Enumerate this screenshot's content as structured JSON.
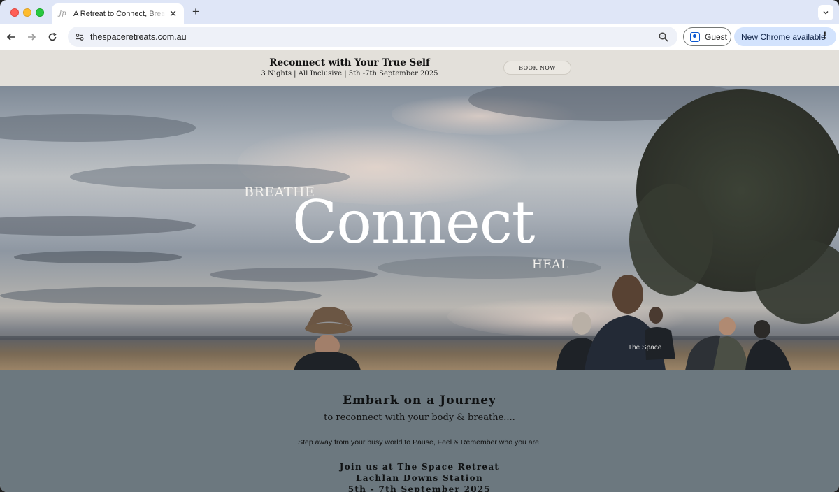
{
  "browser": {
    "tab": {
      "favicon": "Jp",
      "title": "A Retreat to Connect, Breathe & Heal",
      "close_icon": "close-icon"
    },
    "new_tab_icon": "plus-icon",
    "tab_search_icon": "chevron-down-icon",
    "nav": {
      "back_icon": "arrow-left-icon",
      "forward_icon": "arrow-right-icon",
      "reload_icon": "reload-icon"
    },
    "url": "thespaceretreats.com.au",
    "guest_label": "Guest",
    "update_label": "New Chrome available",
    "colors": {
      "tabbar": "#dfe6f7",
      "update_bg": "#d3e3fd",
      "accent": "#0b57d0"
    }
  },
  "announcement": {
    "title": "Reconnect with Your True Self",
    "subtitle": "3 Nights | All Inclusive | 5th -7th September 2025",
    "book_label": "BOOK NOW"
  },
  "hero": {
    "word_top": "BREATHE",
    "word_main": "Connect",
    "word_bottom": "HEAL",
    "shirt_text": "The Space"
  },
  "intro": {
    "title": "Embark on a Journey",
    "subtitle": "to reconnect with your body & breathe....",
    "body": "Step away from your busy world to Pause, Feel & Remember who you are.",
    "join_line1": "Join us at The Space Retreat",
    "join_line2": "Lachlan Downs Station",
    "join_line3": "5th - 7th September 2025",
    "colors": {
      "section_bg": "#6c787f",
      "banner_bg": "#e3e0da"
    }
  }
}
